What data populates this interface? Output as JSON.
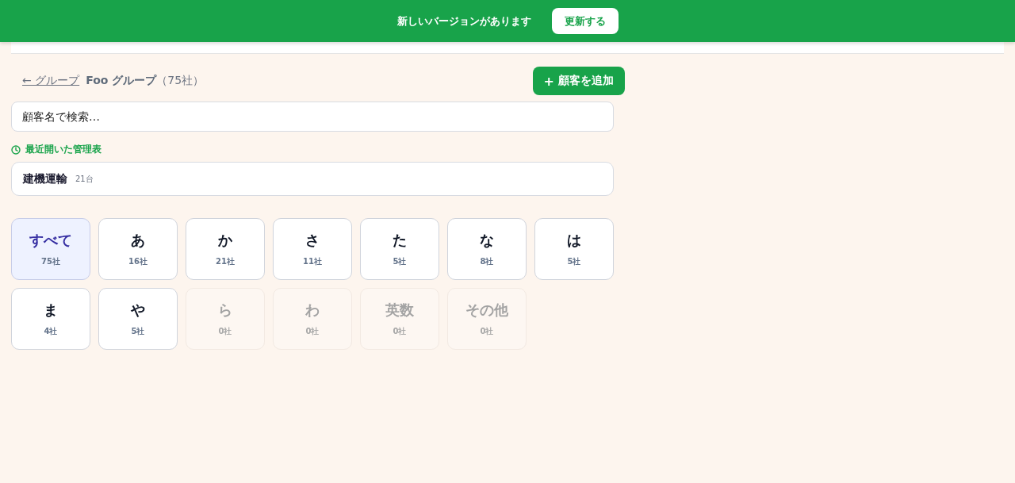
{
  "update_banner": {
    "message": "新しいバージョンがあります",
    "button": "更新する"
  },
  "breadcrumb": {
    "back_link": "← グループ",
    "group_name": "Foo グループ",
    "count": "（75社）"
  },
  "add_button": {
    "icon": "+",
    "label": "顧客を追加"
  },
  "search": {
    "placeholder": "顧客名で検索…"
  },
  "recent": {
    "heading": "最近開いた管理表",
    "items": [
      {
        "name": "建機運輸",
        "count": "21台"
      }
    ]
  },
  "filters": [
    {
      "label": "すべて",
      "count": "75社",
      "selected": true,
      "disabled": false
    },
    {
      "label": "あ",
      "count": "16社",
      "selected": false,
      "disabled": false
    },
    {
      "label": "か",
      "count": "21社",
      "selected": false,
      "disabled": false
    },
    {
      "label": "さ",
      "count": "11社",
      "selected": false,
      "disabled": false
    },
    {
      "label": "た",
      "count": "5社",
      "selected": false,
      "disabled": false
    },
    {
      "label": "な",
      "count": "8社",
      "selected": false,
      "disabled": false
    },
    {
      "label": "は",
      "count": "5社",
      "selected": false,
      "disabled": false
    },
    {
      "label": "ま",
      "count": "4社",
      "selected": false,
      "disabled": false
    },
    {
      "label": "や",
      "count": "5社",
      "selected": false,
      "disabled": false
    },
    {
      "label": "ら",
      "count": "0社",
      "selected": false,
      "disabled": true
    },
    {
      "label": "わ",
      "count": "0社",
      "selected": false,
      "disabled": true
    },
    {
      "label": "英数",
      "count": "0社",
      "selected": false,
      "disabled": true
    },
    {
      "label": "その他",
      "count": "0社",
      "selected": false,
      "disabled": true
    }
  ]
}
